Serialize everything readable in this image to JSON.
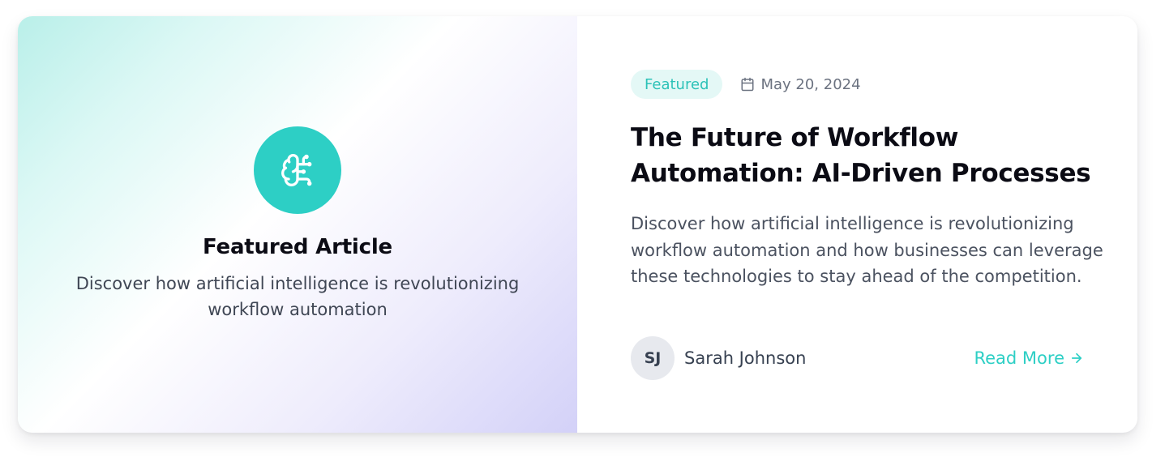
{
  "hero": {
    "icon": "brain-circuit-icon",
    "title": "Featured Article",
    "text": "Discover how artificial intelligence is revolutionizing workflow automation"
  },
  "article": {
    "badge": "Featured",
    "date_icon": "calendar-icon",
    "date": "May 20, 2024",
    "title": "The Future of Workflow Automation: AI-Driven Processes",
    "description": "Discover how artificial intelligence is revolutionizing workflow automation and how businesses can leverage these technologies to stay ahead of the competition."
  },
  "author": {
    "initials": "SJ",
    "name": "Sarah Johnson"
  },
  "cta": {
    "label": "Read More",
    "icon": "arrow-right-icon"
  },
  "colors": {
    "accent": "#2dcfc5",
    "badge_bg": "#e4f8f6",
    "heading": "#0b0b14",
    "body_text": "#4b5260"
  }
}
